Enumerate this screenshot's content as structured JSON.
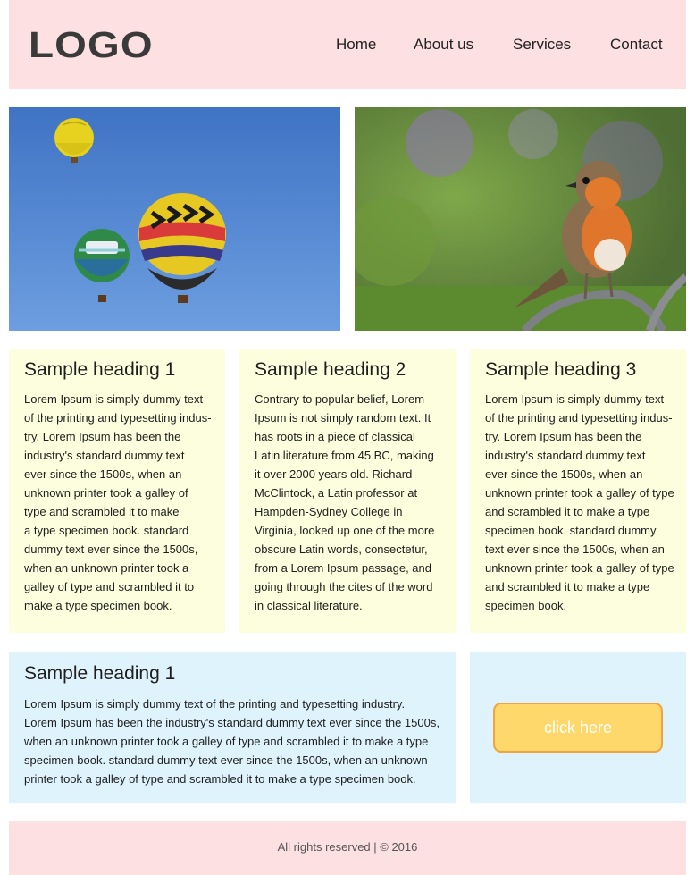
{
  "header": {
    "logo_text": "LOGO",
    "nav": [
      {
        "label": "Home"
      },
      {
        "label": "About us"
      },
      {
        "label": "Services"
      },
      {
        "label": "Contact"
      }
    ]
  },
  "images": [
    {
      "subject": "hot-air-balloons",
      "sky_color": "#4f86cf"
    },
    {
      "subject": "robin-bird",
      "background_color": "#5f8a3e"
    }
  ],
  "cards": [
    {
      "heading": "Sample heading 1",
      "lines": [
        "Lorem Ipsum is simply dummy text",
        "of the printing and typesetting indus-",
        "try. Lorem Ipsum has been the",
        "industry's standard dummy text",
        "ever since the 1500s, when an",
        "unknown printer took a galley of",
        "type and scrambled it to make",
        "a type specimen book. standard",
        "dummy text ever since the 1500s,",
        "when an unknown printer took a",
        "galley of type and scrambled it to",
        "make a type specimen book."
      ]
    },
    {
      "heading": "Sample heading 2",
      "lines": [
        "Contrary to popular belief, Lorem",
        "Ipsum is not simply random text. It",
        "has roots in a piece of classical",
        "Latin literature from 45 BC, making",
        "it over 2000 years old. Richard",
        "McClintock, a Latin professor at",
        "Hampden-Sydney College in",
        "Virginia, looked up one of the more",
        "obscure Latin words, consectetur,",
        "from a Lorem Ipsum passage, and",
        "going through the cites of the word",
        "in classical literature."
      ]
    },
    {
      "heading": "Sample heading 3",
      "lines": [
        "Lorem Ipsum is simply dummy text",
        "of the printing and typesetting indus-",
        "try. Lorem Ipsum has been the",
        "industry's standard dummy text",
        "ever since the 1500s, when an",
        "unknown printer took a galley of type",
        "and scrambled it to make a type",
        "specimen book. standard dummy",
        "text ever since the 1500s, when an",
        "unknown printer took a galley of type",
        "and scrambled it to make a type",
        "specimen book."
      ]
    }
  ],
  "wide_section": {
    "heading": "Sample heading 1",
    "lines": [
      "Lorem Ipsum is simply dummy text of the printing and typesetting industry.",
      "Lorem Ipsum has been the industry's standard dummy text ever since the 1500s,",
      "when an unknown printer took a galley of type and scrambled it to make a type",
      "specimen book. standard dummy text ever since the 1500s, when an unknown",
      "printer took a galley of type and scrambled it to make a type specimen book."
    ]
  },
  "cta": {
    "button_label": "click here"
  },
  "footer": {
    "text": "All rights reserved | © 2016"
  },
  "colors": {
    "header_bg": "#fde0e2",
    "card_bg": "#fdfedd",
    "section_bg": "#dff3fd",
    "button_bg": "#ffd86b",
    "button_border": "#f0a341"
  }
}
